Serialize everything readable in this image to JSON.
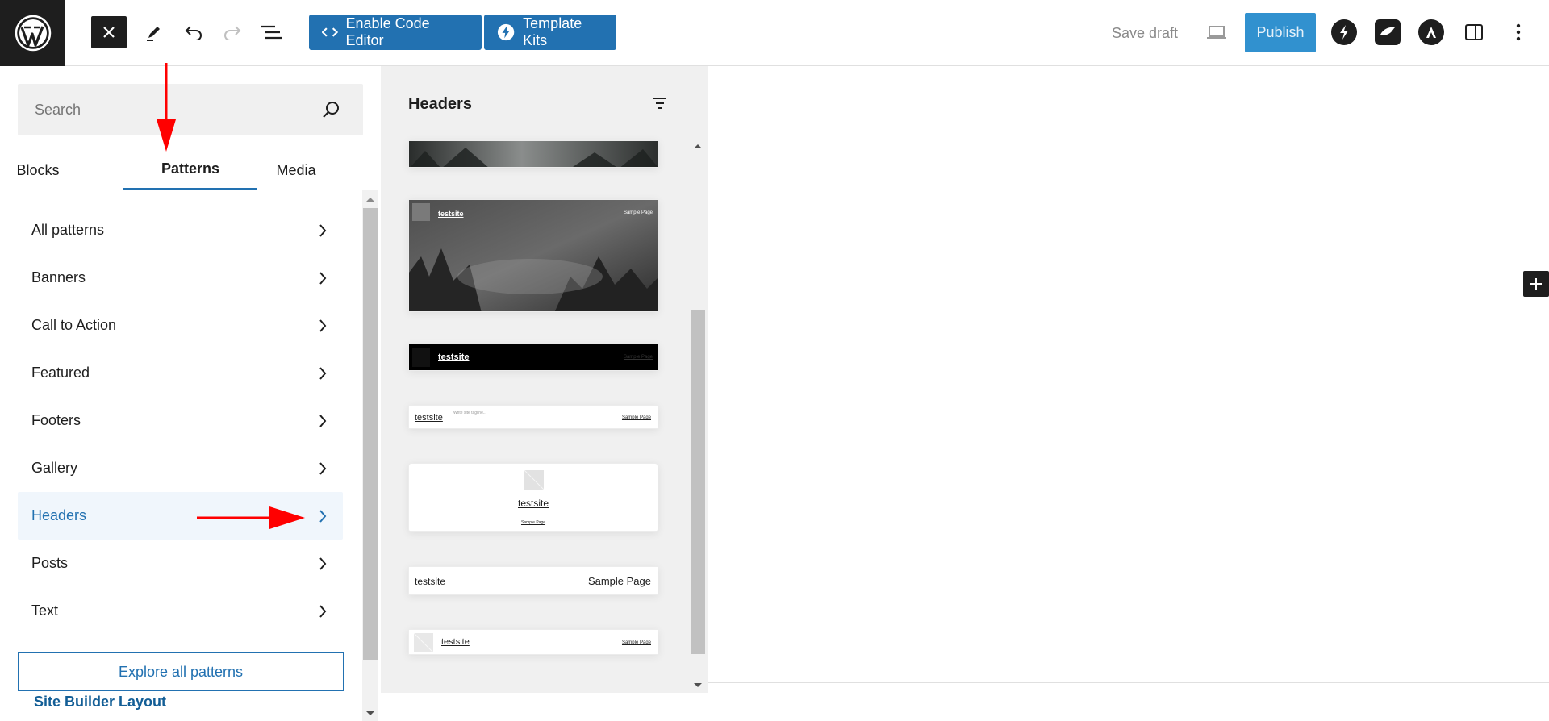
{
  "toolbar": {
    "enable_code_editor": "Enable Code Editor",
    "template_kits": "Template Kits",
    "save_draft": "Save draft",
    "publish": "Publish"
  },
  "sidebar": {
    "search_placeholder": "Search",
    "tabs": [
      "Blocks",
      "Patterns",
      "Media"
    ],
    "active_tab": "Patterns",
    "categories": [
      "All patterns",
      "Banners",
      "Call to Action",
      "Featured",
      "Footers",
      "Gallery",
      "Headers",
      "Posts",
      "Text"
    ],
    "active_category": "Headers",
    "explore_button": "Explore all patterns",
    "site_builder_label": "Site Builder Layout"
  },
  "patterns_panel": {
    "title": "Headers",
    "previews": {
      "site_name": "testsite",
      "sample_page": "Sample Page",
      "tagline": "Write site tagline..."
    }
  },
  "colors": {
    "accent": "#2271b1",
    "publish_bg": "#3191cf",
    "dark": "#1e1e1e",
    "annotation_arrow": "#ff0000"
  }
}
